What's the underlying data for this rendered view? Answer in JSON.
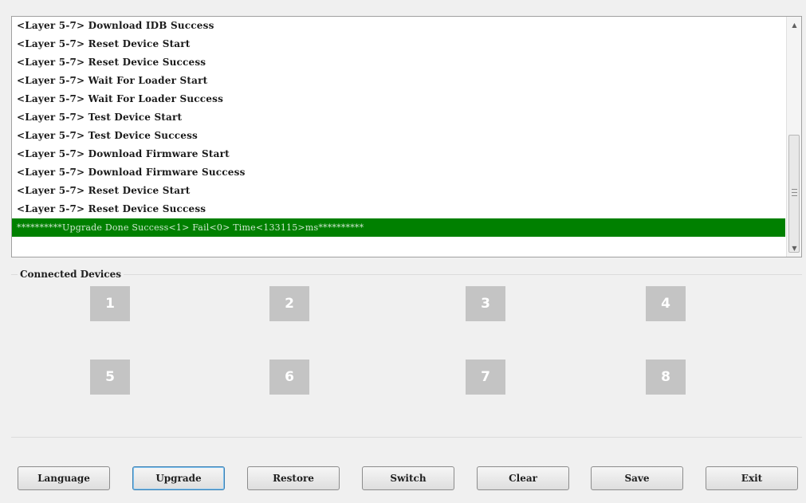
{
  "log": {
    "lines": [
      "<Layer 5-7> Download IDB Success",
      "<Layer 5-7> Reset Device Start",
      "<Layer 5-7> Reset Device Success",
      "<Layer 5-7> Wait For Loader Start",
      "<Layer 5-7> Wait For Loader Success",
      "<Layer 5-7> Test Device Start",
      "<Layer 5-7> Test Device Success",
      "<Layer 5-7> Download Firmware Start",
      "<Layer 5-7> Download Firmware Success",
      "<Layer 5-7> Reset Device Start",
      "<Layer 5-7> Reset Device Success"
    ],
    "summary": "**********Upgrade Done Success<1> Fail<0> Time<133115>ms**********",
    "summary_color": "#008000"
  },
  "devices": {
    "title": "Connected Devices",
    "slots": [
      "1",
      "2",
      "3",
      "4",
      "5",
      "6",
      "7",
      "8"
    ]
  },
  "buttons": {
    "language": "Language",
    "upgrade": "Upgrade",
    "restore": "Restore",
    "switch": "Switch",
    "clear": "Clear",
    "save": "Save",
    "exit": "Exit"
  }
}
